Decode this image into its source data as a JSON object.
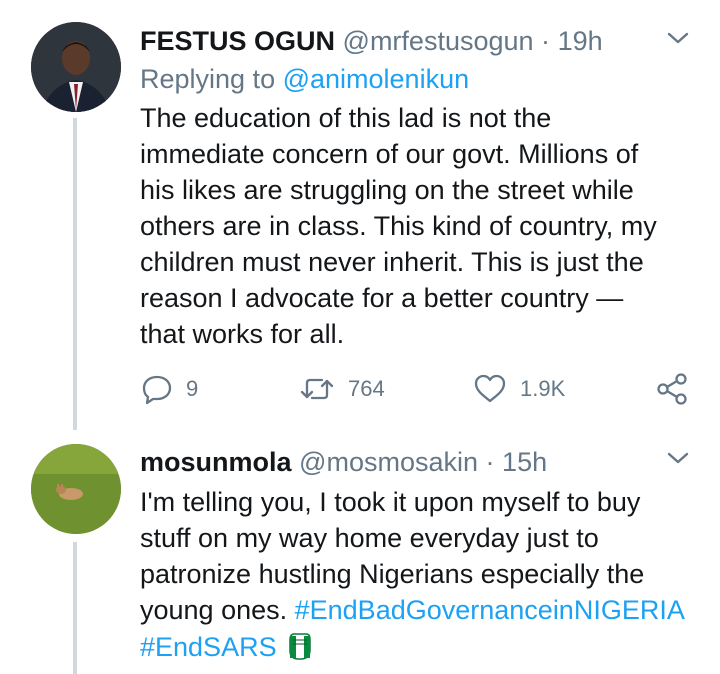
{
  "tweets": [
    {
      "name": "FESTUS OGUN",
      "handle": "@mrfestusogun",
      "dot": "·",
      "time": "19h",
      "replying_prefix": "Replying to ",
      "replying_to": "@animolenikun",
      "text_lines": [
        "The education of this lad is not the",
        "immediate concern of our govt. Millions of",
        "his likes are struggling on the street while",
        "others are in class. This kind of country, my",
        "children must never inherit. This is just the",
        "reason I advocate for a better country —",
        "that works for all."
      ],
      "actions": {
        "reply_icon": "reply-icon",
        "reply_count": "9",
        "retweet_icon": "retweet-icon",
        "retweet_count": "764",
        "like_icon": "heart-icon",
        "like_count": "1.9K",
        "share_icon": "share-icon"
      }
    },
    {
      "name": "mosunmola",
      "handle": "@mosmosakin",
      "dot": "·",
      "time": "15h",
      "text_lines": [
        "I'm telling you, I took it upon myself to buy",
        "stuff on my way home everyday just to",
        "patronize hustling Nigerians especially the"
      ],
      "text_last_plain": "young ones. ",
      "hashtag1": "#EndBadGovernanceinNIGERIA",
      "hashtag2": "#EndSARS",
      "emoji": "raised-fist-nigeria-flag"
    }
  ],
  "colors": {
    "link": "#1da1f2",
    "secondary_text": "#657786",
    "primary_text": "#14171a",
    "thread_line": "#cfd9de"
  }
}
